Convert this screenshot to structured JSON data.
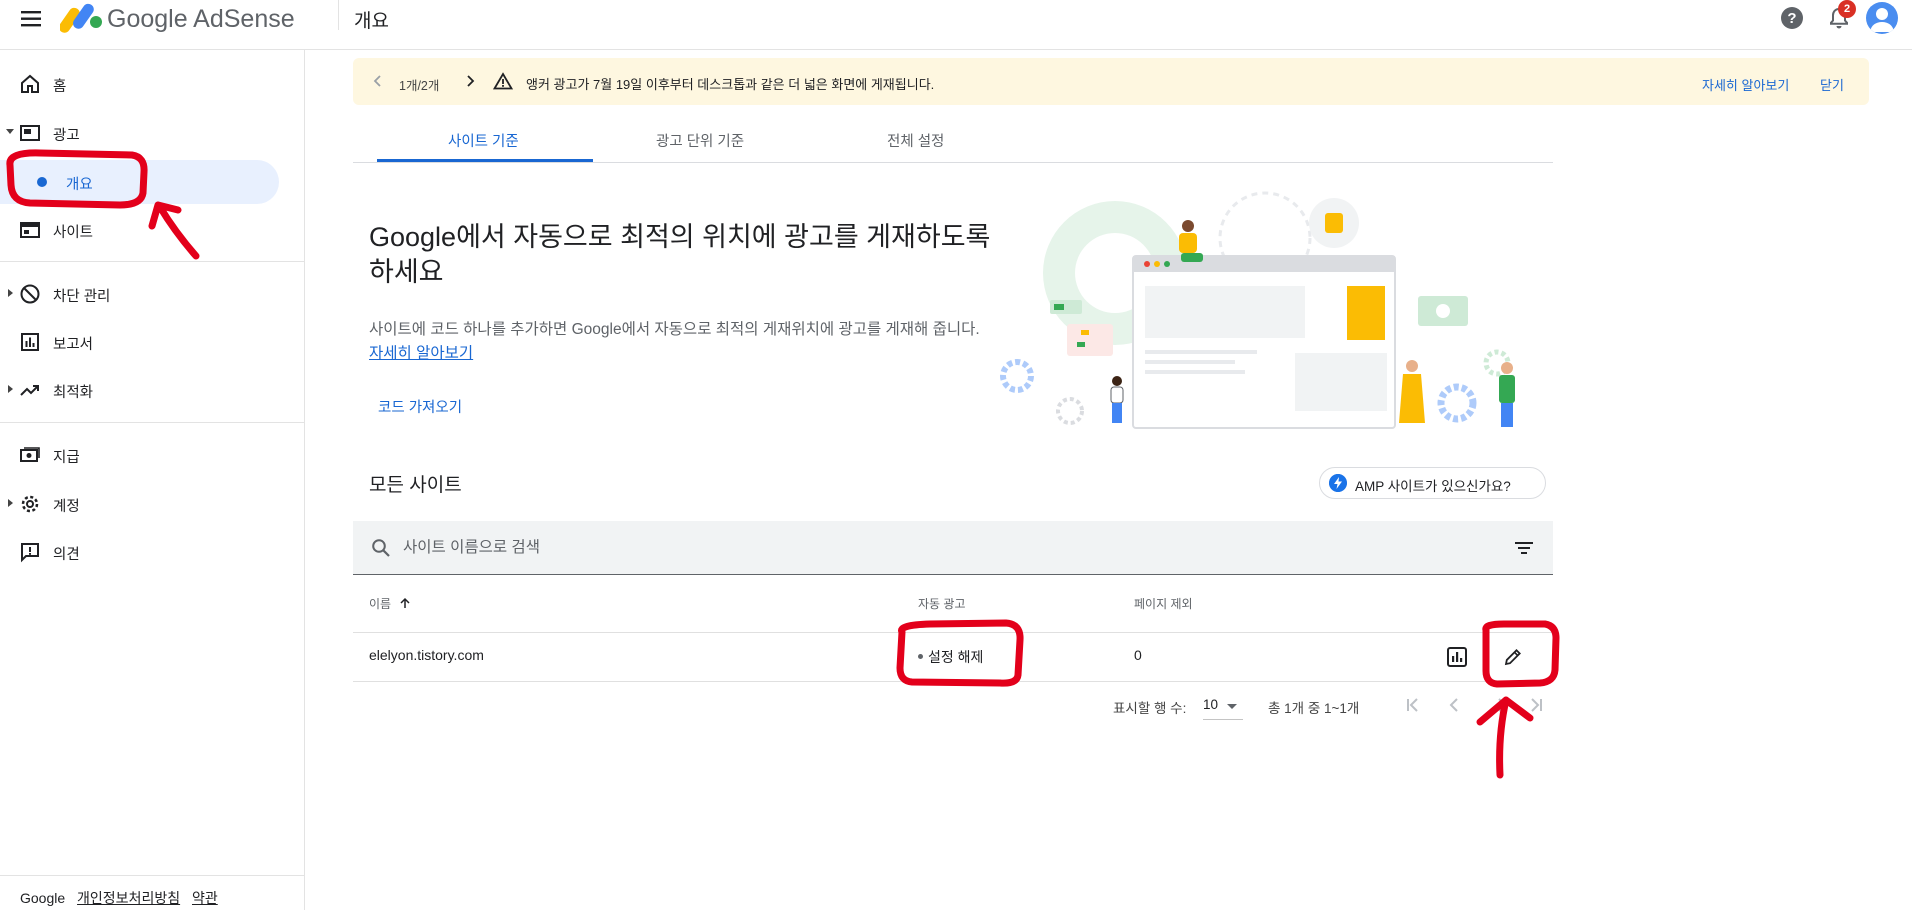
{
  "app": {
    "brand": "Google AdSense",
    "page_title": "개요",
    "notification_count": "2"
  },
  "sidebar": {
    "items": [
      {
        "label": "홈"
      },
      {
        "label": "광고"
      },
      {
        "label": "개요"
      },
      {
        "label": "사이트"
      },
      {
        "label": "차단 관리"
      },
      {
        "label": "보고서"
      },
      {
        "label": "최적화"
      },
      {
        "label": "지급"
      },
      {
        "label": "계정"
      },
      {
        "label": "의견"
      }
    ],
    "footer": {
      "brand": "Google",
      "privacy": "개인정보처리방침",
      "terms": "약관"
    }
  },
  "banner": {
    "pager": "1개/2개",
    "message": "앵커 광고가 7월 19일 이후부터 데스크톱과 같은 더 넓은 화면에 게재됩니다.",
    "learn_more": "자세히 알아보기",
    "close": "닫기"
  },
  "tabs": [
    {
      "label": "사이트 기준"
    },
    {
      "label": "광고 단위 기준"
    },
    {
      "label": "전체 설정"
    }
  ],
  "hero": {
    "title": "Google에서 자동으로 최적의 위치에 광고를 게재하도록 하세요",
    "body": "사이트에 코드 하나를 추가하면 Google에서 자동으로 최적의 게재위치에 광고를 게재해 줍니다.",
    "learn_more": "자세히 알아보기",
    "get_code": "코드 가져오기"
  },
  "sites": {
    "title": "모든 사이트",
    "amp_chip": "AMP 사이트가 있으신가요?",
    "search_placeholder": "사이트 이름으로 검색",
    "columns": {
      "name": "이름",
      "auto_ads": "자동 광고",
      "page_exclusions": "페이지 제외"
    },
    "rows": [
      {
        "name": "elelyon.tistory.com",
        "auto_ads": "설정 해제",
        "page_exclusions": "0"
      }
    ],
    "pagination": {
      "rows_label": "표시할 행 수:",
      "rows_value": "10",
      "range": "총 1개 중 1~1개"
    }
  },
  "colors": {
    "accent": "#1967d2",
    "banner_bg": "#fef7e0",
    "active_nav_bg": "#e8f0fe",
    "annotation": "#e3001b"
  }
}
